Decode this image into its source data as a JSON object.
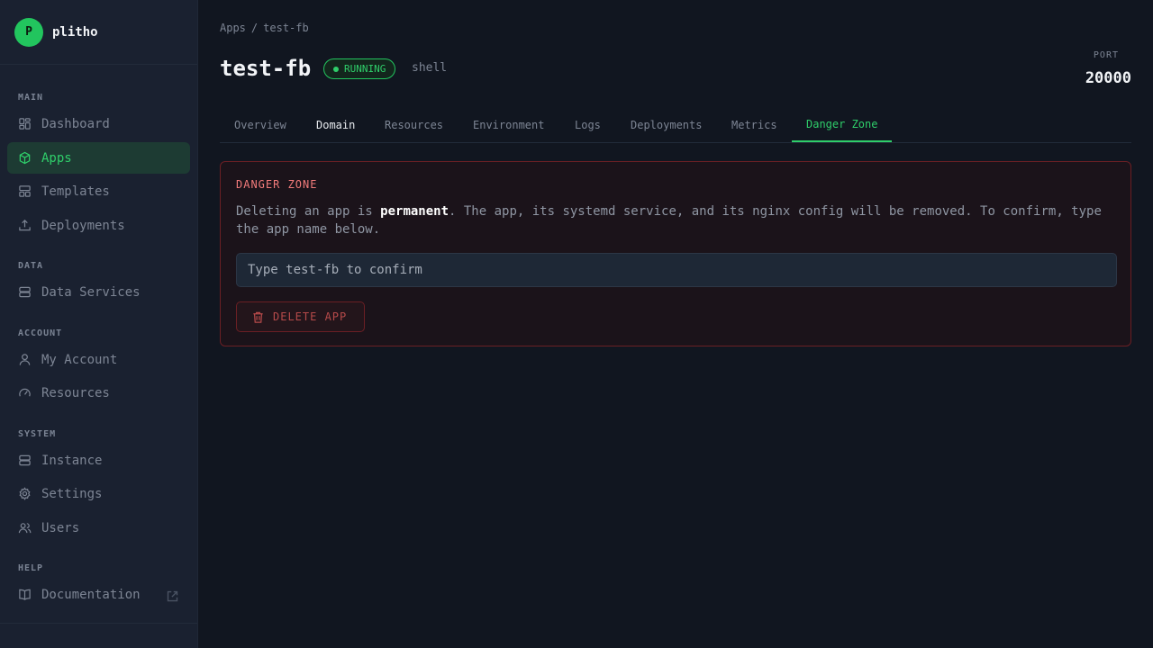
{
  "brand": {
    "logo_letter": "P",
    "name": "plitho"
  },
  "sidebar": {
    "sections": {
      "main": "MAIN",
      "data": "DATA",
      "account": "ACCOUNT",
      "system": "SYSTEM",
      "help": "HELP"
    },
    "items": [
      {
        "label": "Dashboard",
        "icon": "dashboard-icon"
      },
      {
        "label": "Apps",
        "icon": "cube-icon",
        "active": true
      },
      {
        "label": "Templates",
        "icon": "templates-icon"
      },
      {
        "label": "Deployments",
        "icon": "upload-icon"
      },
      {
        "label": "Data Services",
        "icon": "database-icon"
      },
      {
        "label": "My Account",
        "icon": "user-icon"
      },
      {
        "label": "Resources",
        "icon": "gauge-icon"
      },
      {
        "label": "Instance",
        "icon": "server-icon"
      },
      {
        "label": "Settings",
        "icon": "gear-icon"
      },
      {
        "label": "Users",
        "icon": "users-icon"
      },
      {
        "label": "Documentation",
        "icon": "book-icon"
      }
    ]
  },
  "breadcrumb": {
    "parent": "Apps",
    "separator": "/",
    "current": "test-fb"
  },
  "app": {
    "name": "test-fb",
    "status": "RUNNING",
    "runtime": "shell",
    "port_label": "PORT",
    "port_value": "20000"
  },
  "tabs": [
    {
      "label": "Overview"
    },
    {
      "label": "Domain"
    },
    {
      "label": "Resources"
    },
    {
      "label": "Environment"
    },
    {
      "label": "Logs"
    },
    {
      "label": "Deployments"
    },
    {
      "label": "Metrics"
    },
    {
      "label": "Danger Zone",
      "active": true
    }
  ],
  "danger": {
    "title": "DANGER ZONE",
    "text_before": "Deleting an app is ",
    "text_bold": "permanent",
    "text_after": ". The app, its systemd service, and its nginx config will be removed. To confirm, type the app name below.",
    "confirm_placeholder": "Type test-fb to confirm",
    "confirm_value": "",
    "delete_label": "DELETE APP"
  },
  "colors": {
    "accent": "#22c55e",
    "danger": "#f07a7a",
    "background": "#111620",
    "sidebar": "#1a2130"
  }
}
